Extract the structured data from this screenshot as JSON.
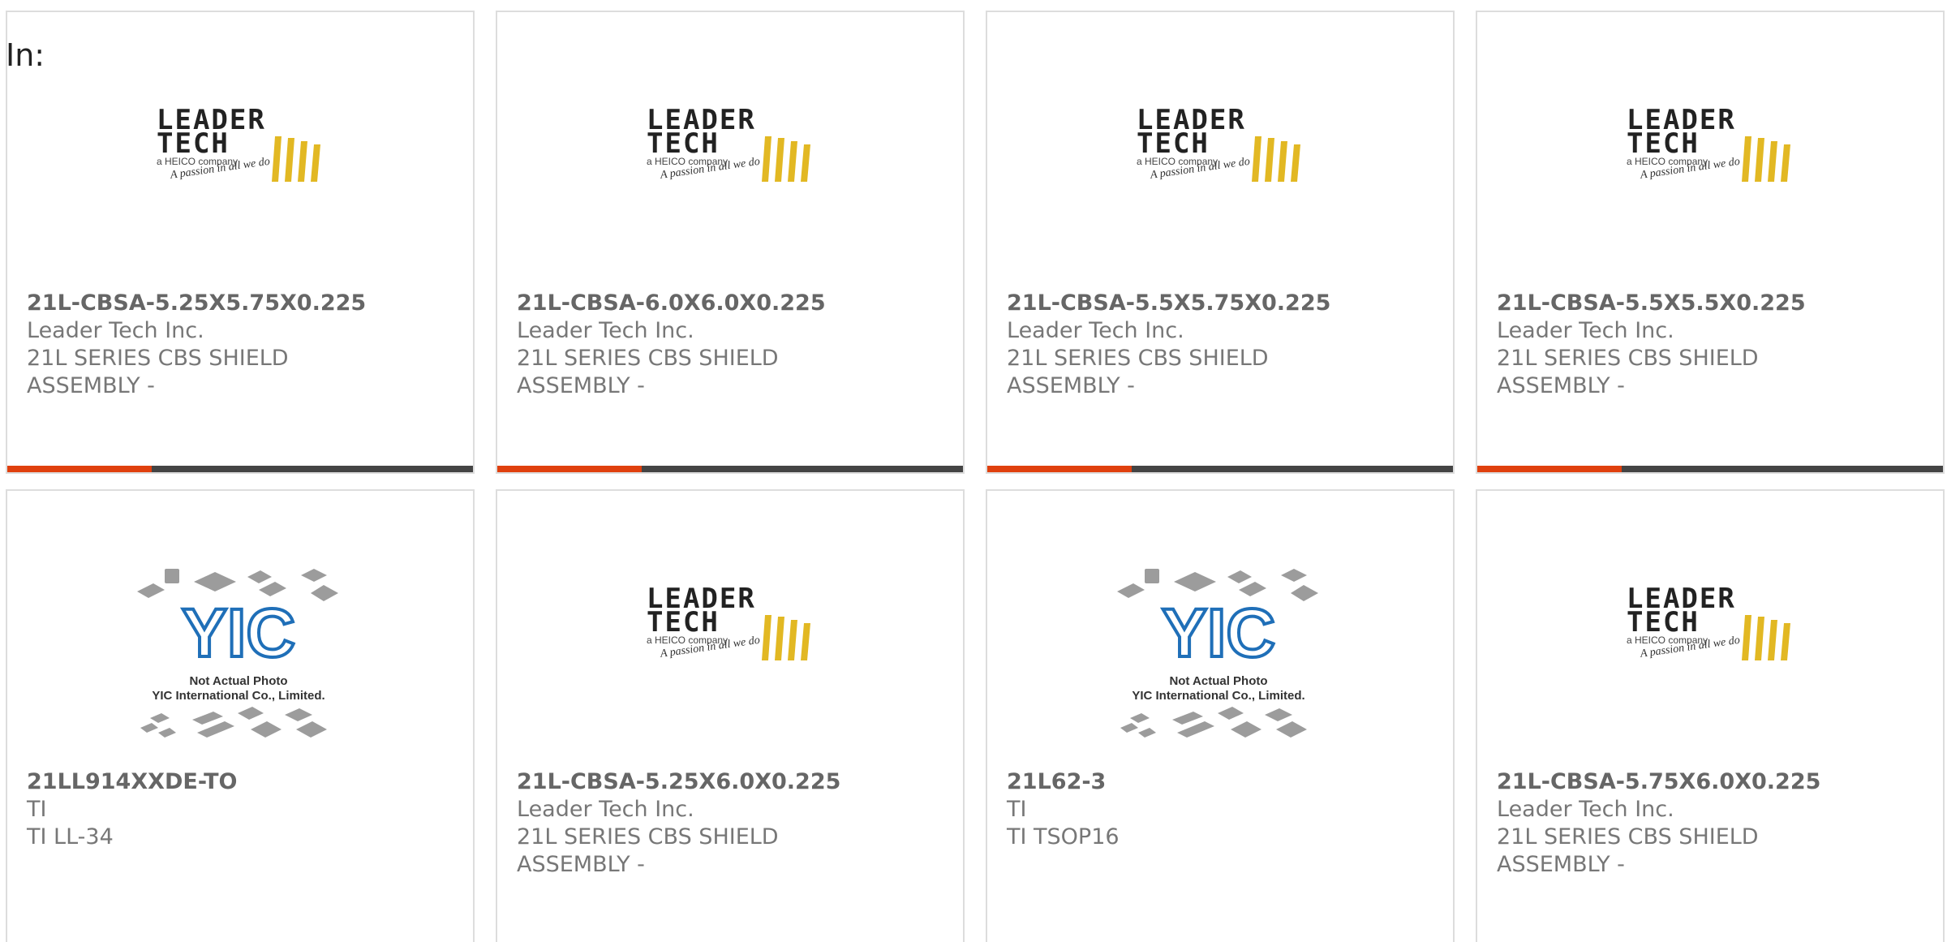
{
  "header": {
    "in_label": "In:"
  },
  "logos": {
    "leader_tech": {
      "line1": "LEADER",
      "line2": "TECH",
      "heico": "a HEICO company",
      "tagline": "A passion in all we do"
    },
    "yic": {
      "mark": "YIC",
      "line1": "Not Actual Photo",
      "line2": "YIC International Co., Limited."
    }
  },
  "colors": {
    "accent": "#e0400e",
    "bar": "#444444",
    "logo_gold": "#e2b823",
    "yic_blue": "#1f6fb8"
  },
  "products": [
    {
      "part_number": "21L-CBSA-5.25X5.75X0.225",
      "manufacturer": "Leader Tech Inc.",
      "description_line1": "21L SERIES CBS SHIELD",
      "description_line2": "ASSEMBLY -",
      "image": "leader-tech-logo",
      "progress": 0.31
    },
    {
      "part_number": "21L-CBSA-6.0X6.0X0.225",
      "manufacturer": "Leader Tech Inc.",
      "description_line1": "21L SERIES CBS SHIELD",
      "description_line2": "ASSEMBLY -",
      "image": "leader-tech-logo",
      "progress": 0.31
    },
    {
      "part_number": "21L-CBSA-5.5X5.75X0.225",
      "manufacturer": "Leader Tech Inc.",
      "description_line1": "21L SERIES CBS SHIELD",
      "description_line2": "ASSEMBLY -",
      "image": "leader-tech-logo",
      "progress": 0.31
    },
    {
      "part_number": "21L-CBSA-5.5X5.5X0.225",
      "manufacturer": "Leader Tech Inc.",
      "description_line1": "21L SERIES CBS SHIELD",
      "description_line2": "ASSEMBLY -",
      "image": "leader-tech-logo",
      "progress": 0.31
    },
    {
      "part_number": "21LL914XXDE-TO",
      "manufacturer": "TI",
      "description_line1": "TI LL-34",
      "description_line2": "",
      "image": "yic-not-actual-photo"
    },
    {
      "part_number": "21L-CBSA-5.25X6.0X0.225",
      "manufacturer": "Leader Tech Inc.",
      "description_line1": "21L SERIES CBS SHIELD",
      "description_line2": "ASSEMBLY -",
      "image": "leader-tech-logo"
    },
    {
      "part_number": "21L62-3",
      "manufacturer": "TI",
      "description_line1": "TI TSOP16",
      "description_line2": "",
      "image": "yic-not-actual-photo"
    },
    {
      "part_number": "21L-CBSA-5.75X6.0X0.225",
      "manufacturer": "Leader Tech Inc.",
      "description_line1": "21L SERIES CBS SHIELD",
      "description_line2": "ASSEMBLY -",
      "image": "leader-tech-logo"
    }
  ]
}
